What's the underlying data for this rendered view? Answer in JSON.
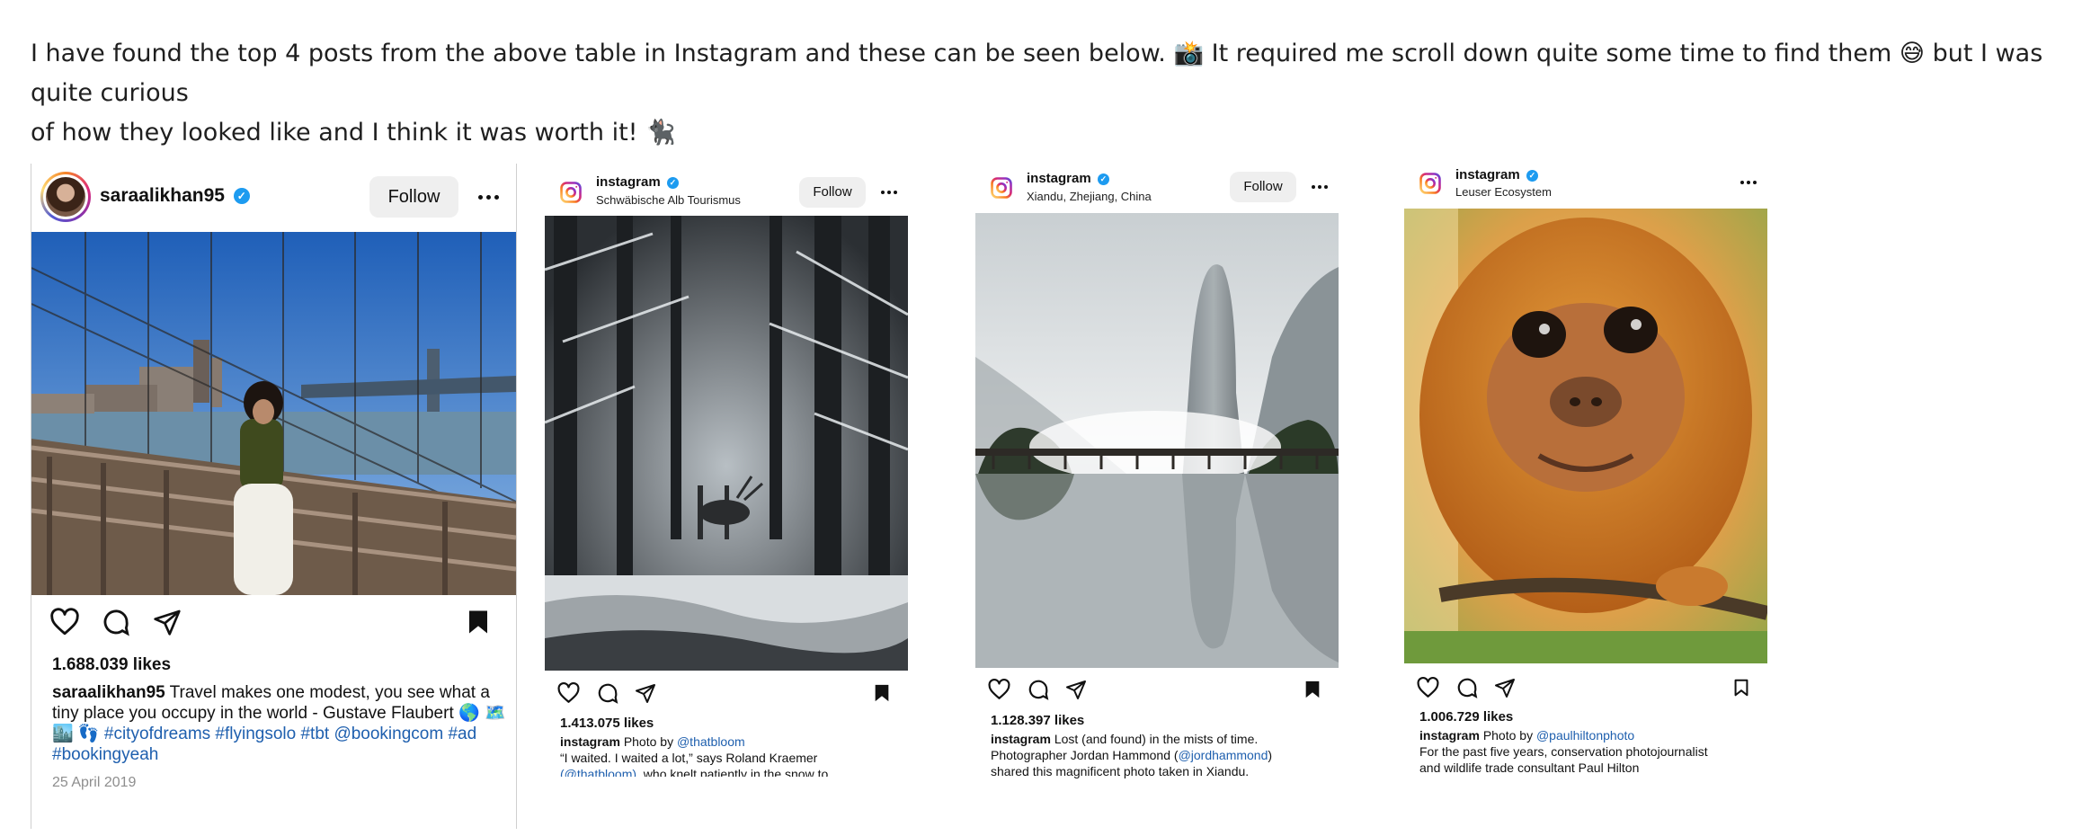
{
  "intro": {
    "line1": "I have found the top 4 posts from the above table in Instagram and these can be seen below. 📸 It required me scroll down quite some time to find them 😅 but I was quite curious",
    "line2": "of how they looked like and I think it was worth it! 🐈‍⬛"
  },
  "posts": [
    {
      "username": "saraalikhan95",
      "follow_label": "Follow",
      "photo": "Woman on the Brooklyn Bridge with Manhattan Bridge and city skyline",
      "likes": "1.688.039 likes",
      "caption_user": "saraalikhan95",
      "caption_text": "Travel makes one modest, you see what a tiny place you occupy in the world - Gustave Flaubert 🌎 🗺️ 🏙️ 👣",
      "hashtags": "#cityofdreams #flyingsolo #tbt @bookingcom #ad #bookingyeah",
      "date": "25 April 2019"
    },
    {
      "username": "instagram",
      "location": "Schwäbische Alb Tourismus",
      "follow_label": "Follow",
      "photo": "Snowy misty forest with a deer",
      "likes": "1.413.075 likes",
      "caption_user": "instagram",
      "caption_prefix": "Photo by",
      "caption_mention": "@thatbloom",
      "caption_line2": "“I waited. I waited a lot,” says Roland Kraemer",
      "caption_line3_mention": "(@thatbloom)",
      "caption_line3_text": ", who knelt patiently in the snow to"
    },
    {
      "username": "instagram",
      "location": "Xiandu, Zhejiang, China",
      "follow_label": "Follow",
      "photo": "Misty lake with a rock pillar and a bridge",
      "likes": "1.128.397 likes",
      "caption_user": "instagram",
      "caption_text": "Lost (and found) in the mists of time.",
      "caption_line2_text": "Photographer Jordan Hammond (",
      "caption_line2_mention": "@jordhammond",
      "caption_line2_end": ")",
      "caption_line3": "shared this magnificent photo taken in Xiandu."
    },
    {
      "username": "instagram",
      "location": "Leuser Ecosystem",
      "photo": "Close-up of a baby orangutan",
      "likes": "1.006.729 likes",
      "caption_user": "instagram",
      "caption_prefix": "Photo by",
      "caption_mention": "@paulhiltonphoto",
      "caption_line2": "For the past five years, conservation photojournalist",
      "caption_line3": "and wildlife trade consultant Paul Hilton"
    }
  ],
  "colors": {
    "link": "#1e5fae",
    "verified": "#1d9bf0",
    "follow_bg": "#efefef"
  },
  "icons": [
    "verified-badge-icon",
    "more-options-icon",
    "heart-icon",
    "comment-icon",
    "share-icon",
    "bookmark-icon",
    "instagram-logo-icon"
  ]
}
